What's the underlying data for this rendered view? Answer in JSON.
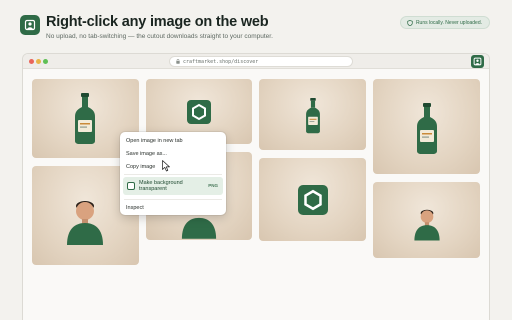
{
  "header": {
    "title": "Right-click any image on the web",
    "subtitle": "No upload, no tab-switching — the cutout downloads straight to your computer.",
    "badge": "Runs locally. Never uploaded.",
    "icon": "portrait-icon"
  },
  "browser": {
    "url": "craftmarket.shop/discover",
    "extension_icon": "portrait-icon"
  },
  "gallery": {
    "items": [
      {
        "subject": "bottle"
      },
      {
        "subject": "logo-badge"
      },
      {
        "subject": "bottle"
      },
      {
        "subject": "bottle"
      },
      {
        "subject": "person"
      },
      {
        "subject": "person"
      },
      {
        "subject": "logo-badge"
      },
      {
        "subject": "person"
      }
    ]
  },
  "context_menu": {
    "items": [
      "Open image in new tab",
      "Save image as...",
      "Copy image"
    ],
    "feature": {
      "label": "Make background transparent",
      "tag": "PNG"
    },
    "inspect": "Inspect"
  },
  "colors": {
    "accent": "#2f6b47",
    "background": "#f3f2ee",
    "tile": "#e3d4c1"
  }
}
